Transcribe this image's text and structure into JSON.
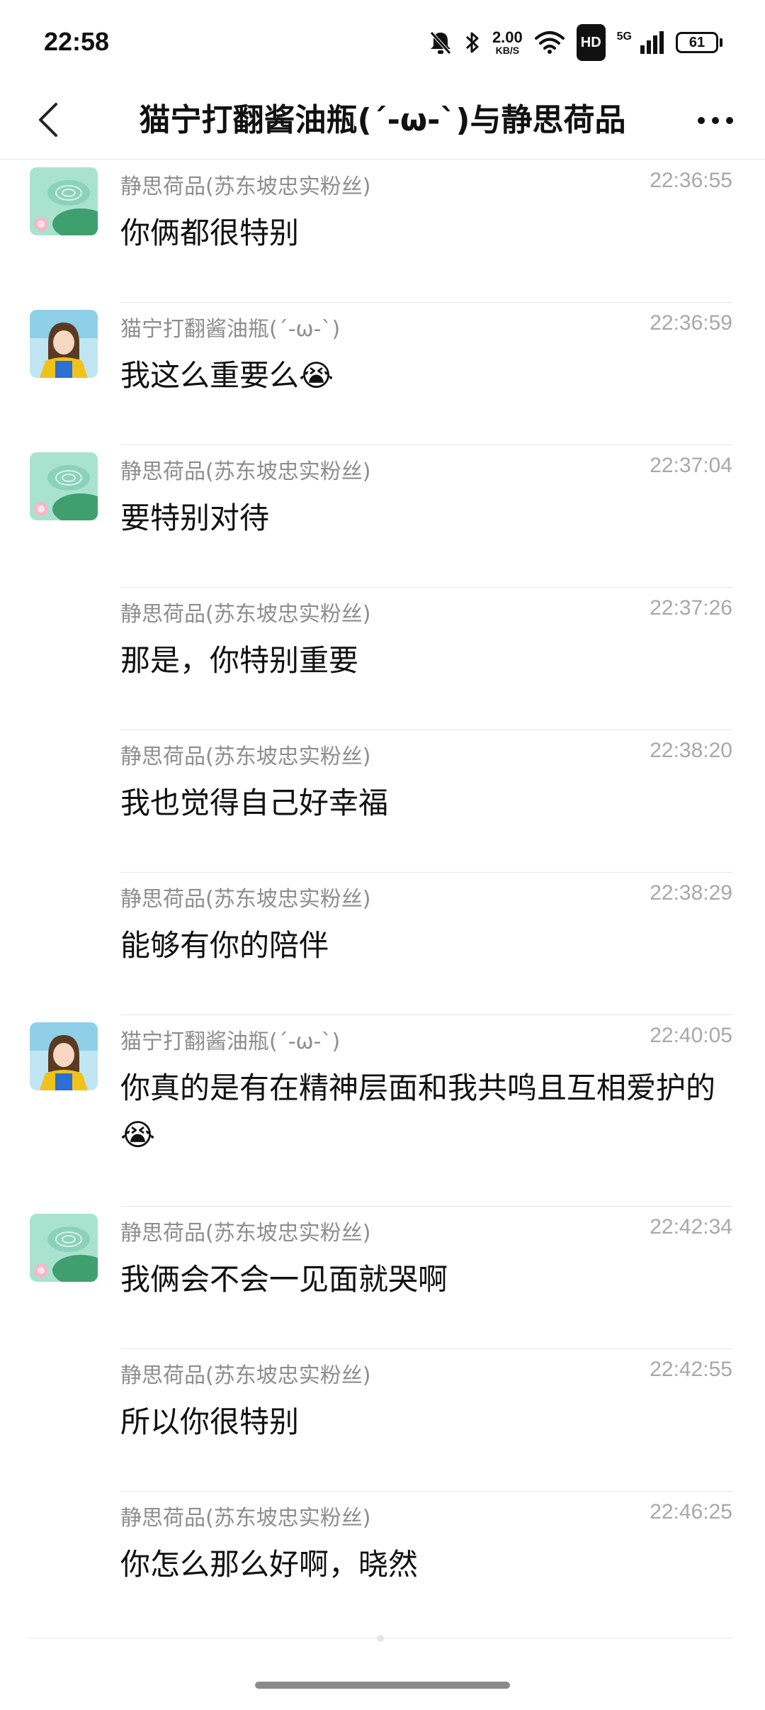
{
  "status_bar": {
    "time": "22:58",
    "net_speed": "2.00",
    "net_speed_unit": "KB/S",
    "hd_label": "HD",
    "network_label": "5G",
    "battery": "61",
    "icons": [
      "mute-bell-icon",
      "bluetooth-icon",
      "wifi-icon",
      "signal-icon"
    ]
  },
  "header": {
    "title": "猫宁打翻酱油瓶(´-ω-`)与静思荷品",
    "back_icon": "chevron-left-icon",
    "more_icon": "more-dots-icon"
  },
  "messages": [
    {
      "avatar": "lotus",
      "name": "静思荷品(苏东坡忠实粉丝)",
      "time": "22:36:55",
      "text": "你俩都很特别"
    },
    {
      "avatar": "girl",
      "name": "猫宁打翻酱油瓶(´-ω-`)",
      "time": "22:36:59",
      "text": "我这么重要么😭"
    },
    {
      "avatar": "lotus",
      "name": "静思荷品(苏东坡忠实粉丝)",
      "time": "22:37:04",
      "text": "要特别对待"
    },
    {
      "avatar": "",
      "name": "静思荷品(苏东坡忠实粉丝)",
      "time": "22:37:26",
      "text": "那是，你特别重要"
    },
    {
      "avatar": "",
      "name": "静思荷品(苏东坡忠实粉丝)",
      "time": "22:38:20",
      "text": "我也觉得自己好幸福"
    },
    {
      "avatar": "",
      "name": "静思荷品(苏东坡忠实粉丝)",
      "time": "22:38:29",
      "text": "能够有你的陪伴"
    },
    {
      "avatar": "girl",
      "name": "猫宁打翻酱油瓶(´-ω-`)",
      "time": "22:40:05",
      "text": "你真的是有在精神层面和我共鸣且互相爱护的😭"
    },
    {
      "avatar": "lotus",
      "name": "静思荷品(苏东坡忠实粉丝)",
      "time": "22:42:34",
      "text": "我俩会不会一见面就哭啊"
    },
    {
      "avatar": "",
      "name": "静思荷品(苏东坡忠实粉丝)",
      "time": "22:42:55",
      "text": "所以你很特别"
    },
    {
      "avatar": "",
      "name": "静思荷品(苏东坡忠实粉丝)",
      "time": "22:46:25",
      "text": "你怎么那么好啊，晓然"
    }
  ],
  "colors": {
    "name_gray": "#8d8d8d",
    "time_gray": "#a8a8a8",
    "divider": "#e6e6e6",
    "lotus_green": "#6fc3a0",
    "girl_yellow": "#f1c21b"
  }
}
